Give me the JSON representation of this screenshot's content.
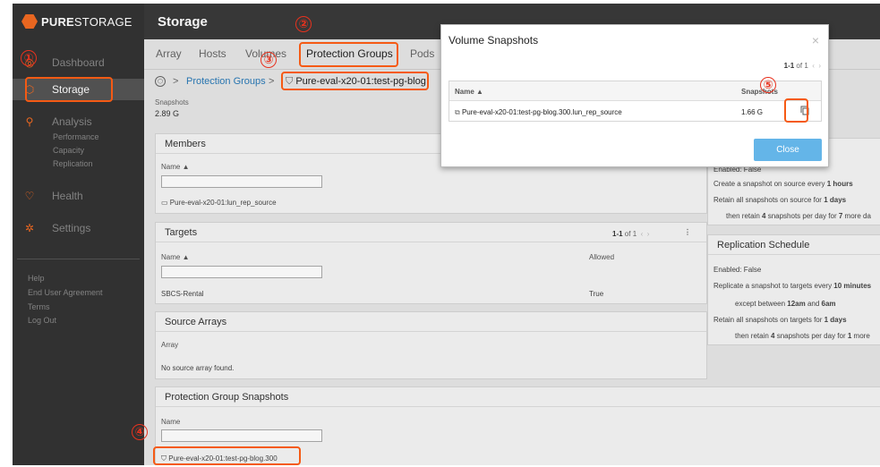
{
  "brand": {
    "name_bold": "PURE",
    "name_light": "STORAGE"
  },
  "sidebar": {
    "items": [
      {
        "label": "Dashboard"
      },
      {
        "label": "Storage"
      },
      {
        "label": "Analysis"
      },
      {
        "label": "Health"
      },
      {
        "label": "Settings"
      }
    ],
    "analysis_sub": [
      "Performance",
      "Capacity",
      "Replication"
    ],
    "footer": [
      "Help",
      "End User Agreement",
      "Terms",
      "Log Out"
    ]
  },
  "header": {
    "title": "Storage"
  },
  "tabs": [
    {
      "label": "Array"
    },
    {
      "label": "Hosts"
    },
    {
      "label": "Volumes"
    },
    {
      "label": "Protection Groups"
    },
    {
      "label": "Pods"
    }
  ],
  "breadcrumb": {
    "sep": ">",
    "parent": "Protection Groups",
    "current": "Pure-eval-x20-01:test-pg-blog"
  },
  "snapshots_summary": {
    "label": "Snapshots",
    "value": "2.89 G"
  },
  "members": {
    "title": "Members",
    "col": "Name",
    "row": "Pure-eval-x20-01:lun_rep_source"
  },
  "targets": {
    "title": "Targets",
    "pager_range": "1-1",
    "pager_of": "of 1",
    "col_name": "Name",
    "col_allowed": "Allowed",
    "row_name": "SBCS-Rental",
    "row_allowed": "True"
  },
  "source_arrays": {
    "title": "Source Arrays",
    "col": "Array",
    "empty": "No source array found."
  },
  "pg_snapshots": {
    "title": "Protection Group Snapshots",
    "col": "Name",
    "row": "Pure-eval-x20-01:test-pg-blog.300"
  },
  "snapshot_schedule": {
    "enabled": "Enabled: False",
    "line1_a": "Create a snapshot on source every ",
    "line1_b": "1 hours",
    "line2_a": "Retain all snapshots on source for ",
    "line2_b": "1 days",
    "line3_a": "then retain ",
    "line3_b": "4",
    "line3_c": " snapshots per day for ",
    "line3_d": "7",
    "line3_e": " more da"
  },
  "replication_schedule": {
    "title": "Replication Schedule",
    "enabled": "Enabled: False",
    "line1_a": "Replicate a snapshot to targets every ",
    "line1_b": "10 minutes",
    "line2_a": "except between ",
    "line2_b": "12am",
    "line2_c": " and ",
    "line2_d": "6am",
    "line3_a": "Retain all snapshots on targets for ",
    "line3_b": "1 days",
    "line4_a": "then retain ",
    "line4_b": "4",
    "line4_c": " snapshots per day for ",
    "line4_d": "1",
    "line4_e": " more"
  },
  "modal": {
    "title": "Volume Snapshots",
    "pager_range": "1-1",
    "pager_of": "of 1",
    "col_name": "Name",
    "col_snapshots": "Snapshots",
    "row_name": "Pure-eval-x20-01:test-pg-blog.300.lun_rep_source",
    "row_size": "1.66 G",
    "close_label": "Close"
  },
  "annotations": [
    "①",
    "②",
    "③",
    "④",
    "⑤"
  ],
  "colors": {
    "accent": "#f26b22",
    "annotation": "#e8321e",
    "link": "#2a7ab8",
    "close_btn": "#64b5e8"
  }
}
